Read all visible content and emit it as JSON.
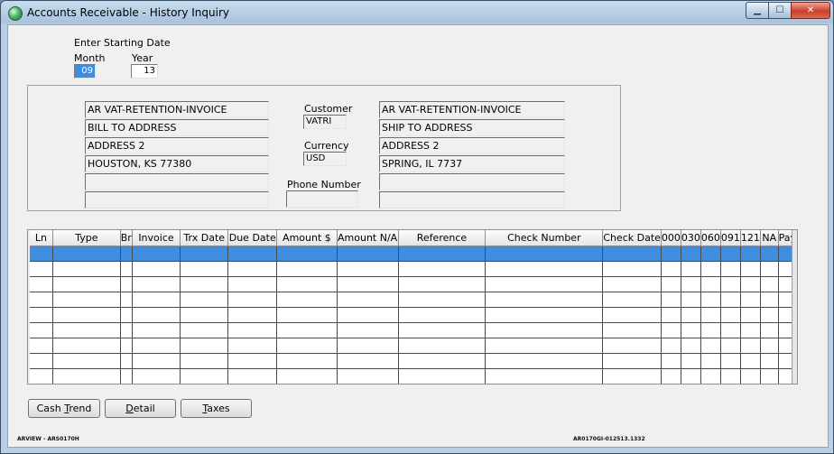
{
  "window": {
    "title": "Accounts Receivable - History Inquiry",
    "controls": {
      "minimize": "▁",
      "maximize": "☐",
      "close": "✕"
    }
  },
  "date_entry": {
    "heading": "Enter Starting Date",
    "month_label": "Month",
    "month_value": "09",
    "year_label": "Year",
    "year_value": "13"
  },
  "bill_to": {
    "lines": [
      "AR VAT-RETENTION-INVOICE",
      "BILL TO ADDRESS",
      "ADDRESS 2",
      "HOUSTON, KS 77380",
      "",
      ""
    ]
  },
  "ship_to": {
    "lines": [
      "AR VAT-RETENTION-INVOICE",
      "SHIP TO ADDRESS",
      "ADDRESS 2",
      "SPRING, IL 7737",
      "",
      ""
    ]
  },
  "customer": {
    "label": "Customer",
    "value": "VATRI"
  },
  "currency": {
    "label": "Currency",
    "value": "USD"
  },
  "phone": {
    "label": "Phone Number",
    "value": ""
  },
  "grid": {
    "columns": [
      "Ln",
      "Type",
      "Br",
      "Invoice",
      "Trx Date",
      "Due Date",
      "Amount $",
      "Amount N/A",
      "Reference",
      "Check Number",
      "Check Date",
      "000",
      "030",
      "060",
      "091",
      "121",
      "NA",
      "Pay"
    ]
  },
  "buttons": {
    "cash_trend": {
      "pre": "Cash ",
      "accel": "T",
      "post": "rend"
    },
    "detail": {
      "pre": "",
      "accel": "D",
      "post": "etail"
    },
    "taxes": {
      "pre": "",
      "accel": "T",
      "post": "axes"
    }
  },
  "footer": {
    "left": "ARVIEW - ARS0170H",
    "right": "AR0170GI-012513.1332"
  },
  "colors": {
    "selection": "#3d8ee0",
    "window_frame": "#b9cfe5",
    "client_bg": "#f0f0f0"
  }
}
